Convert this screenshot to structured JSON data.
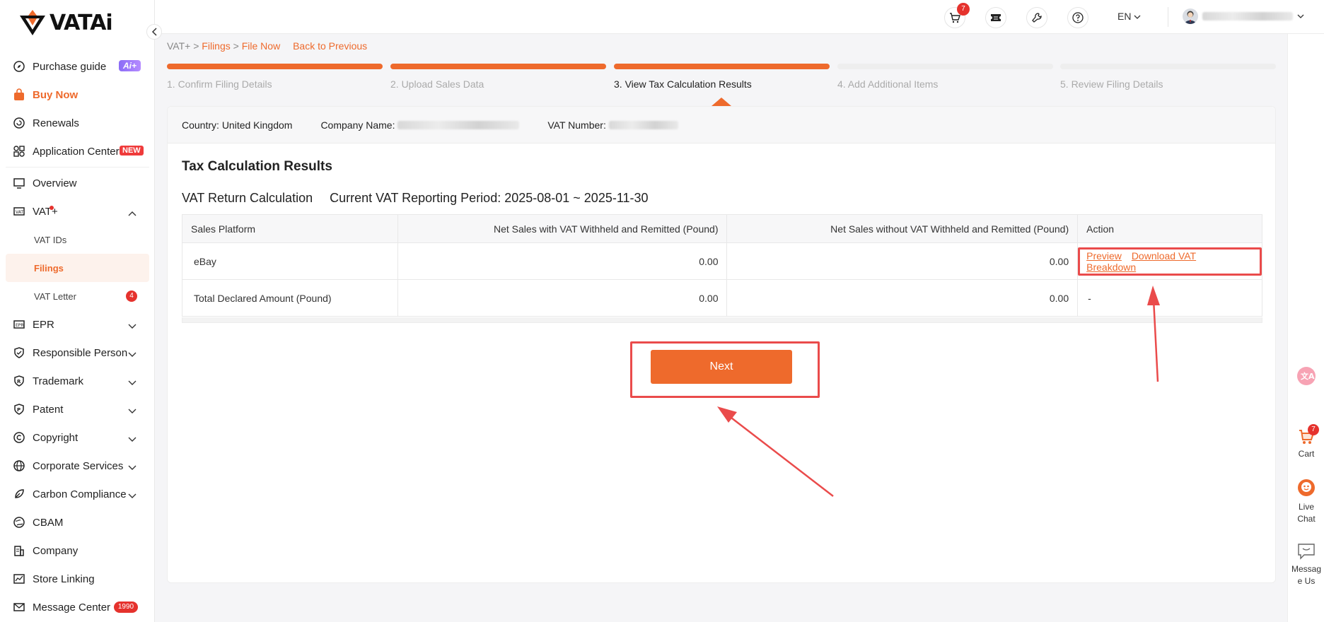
{
  "brand": {
    "name": "VATAi",
    "accent": "#ee6a2c"
  },
  "sidebar": {
    "items": [
      {
        "label": "Purchase guide",
        "badge": "Ai+"
      },
      {
        "label": "Buy Now"
      },
      {
        "label": "Renewals"
      },
      {
        "label": "Application Center",
        "badge": "NEW"
      },
      {
        "label": "Overview"
      },
      {
        "label": "VAT+"
      },
      {
        "label": "VAT IDs"
      },
      {
        "label": "Filings"
      },
      {
        "label": "VAT Letter",
        "badge": "4"
      },
      {
        "label": "EPR"
      },
      {
        "label": "Responsible Person"
      },
      {
        "label": "Trademark"
      },
      {
        "label": "Patent"
      },
      {
        "label": "Copyright"
      },
      {
        "label": "Corporate Services"
      },
      {
        "label": "Carbon Compliance"
      },
      {
        "label": "CBAM"
      },
      {
        "label": "Company"
      },
      {
        "label": "Store Linking"
      },
      {
        "label": "Message Center",
        "badge": "1990"
      }
    ]
  },
  "topbar": {
    "cart_count": "7",
    "language": "EN"
  },
  "breadcrumb": {
    "root": "VAT+",
    "sep1": " > ",
    "filings": "Filings",
    "sep2": " > ",
    "current": "File Now",
    "back": "Back to Previous"
  },
  "steps": [
    "1. Confirm Filing Details",
    "2. Upload Sales Data",
    "3. View Tax Calculation Results",
    "4. Add Additional Items",
    "5. Review Filing Details"
  ],
  "info": {
    "country_label": "Country:",
    "country_value": "United Kingdom",
    "company_label": "Company Name:",
    "vat_label": "VAT Number:"
  },
  "main": {
    "section_title": "Tax Calculation Results",
    "subtitle": "VAT Return Calculation",
    "period": "Current VAT Reporting Period: 2025-08-01 ~ 2025-11-30",
    "next_label": "Next"
  },
  "table": {
    "headers": [
      "Sales Platform",
      "Net Sales with VAT Withheld and Remitted (Pound)",
      "Net Sales without VAT Withheld and Remitted (Pound)",
      "Action"
    ],
    "rows": [
      {
        "platform": "eBay",
        "with_vat": "0.00",
        "without_vat": "0.00",
        "preview": "Preview",
        "download": "Download VAT Breakdown"
      },
      {
        "platform": "Total Declared Amount (Pound)",
        "with_vat": "0.00",
        "without_vat": "0.00",
        "action": "-"
      }
    ]
  },
  "floating": {
    "cart_label": "Cart",
    "cart_count": "7",
    "chat_label_1": "Live",
    "chat_label_2": "Chat",
    "msg_label_1": "Messag",
    "msg_label_2": "e Us"
  }
}
